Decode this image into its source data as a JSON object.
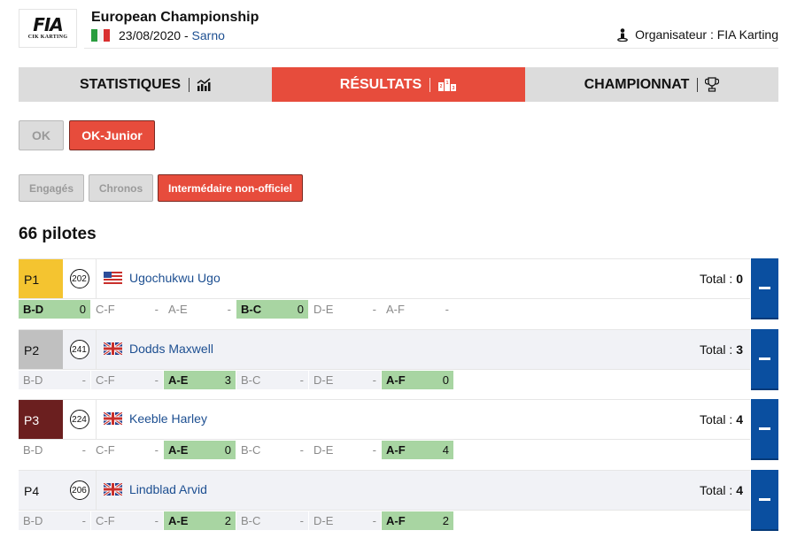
{
  "header": {
    "logo_text": "FIA",
    "logo_subtext": "CIK KARTING",
    "event_title": "European Championship",
    "event_flag": "italy-flag",
    "event_date": "23/08/2020",
    "date_separator": " - ",
    "event_place": "Sarno",
    "organiser_icon": "person-icon",
    "organiser": "Organisateur : FIA Karting"
  },
  "tabs": [
    {
      "label": "STATISTIQUES",
      "icon": "chart-icon",
      "active": false
    },
    {
      "label": "RÉSULTATS",
      "icon": "podium-icon",
      "active": true
    },
    {
      "label": "CHAMPIONNAT",
      "icon": "trophy-icon",
      "active": false
    }
  ],
  "categories": [
    {
      "label": "OK",
      "active": false
    },
    {
      "label": "OK-Junior",
      "active": true
    }
  ],
  "sessions": [
    {
      "label": "Engagés",
      "active": false
    },
    {
      "label": "Chronos",
      "active": false
    },
    {
      "label": "Intermédaire non-officiel",
      "active": true
    }
  ],
  "pilot_count": "66 pilotes",
  "colors": {
    "accent_red": "#e74c3c",
    "link_blue": "#1d4f91",
    "toggle_blue": "#0a4fa0",
    "p1": "#f4c430",
    "p2": "#c0c0c0",
    "p3": "#6b1f1f",
    "scored_green": "#a8d5a2"
  },
  "pilots": [
    {
      "position": "P1",
      "number": "202",
      "flag": "usa-flag",
      "name": "Ugochukwu Ugo",
      "total_label": "Total : ",
      "total": "0",
      "heats": [
        {
          "label": "B-D",
          "value": "0",
          "scored": true
        },
        {
          "label": "C-F",
          "value": "-",
          "scored": false
        },
        {
          "label": "A-E",
          "value": "-",
          "scored": false
        },
        {
          "label": "B-C",
          "value": "0",
          "scored": true
        },
        {
          "label": "D-E",
          "value": "-",
          "scored": false
        },
        {
          "label": "A-F",
          "value": "-",
          "scored": false
        }
      ]
    },
    {
      "position": "P2",
      "number": "241",
      "flag": "uk-flag",
      "name": "Dodds Maxwell",
      "total_label": "Total : ",
      "total": "3",
      "heats": [
        {
          "label": "B-D",
          "value": "-",
          "scored": false
        },
        {
          "label": "C-F",
          "value": "-",
          "scored": false
        },
        {
          "label": "A-E",
          "value": "3",
          "scored": true
        },
        {
          "label": "B-C",
          "value": "-",
          "scored": false
        },
        {
          "label": "D-E",
          "value": "-",
          "scored": false
        },
        {
          "label": "A-F",
          "value": "0",
          "scored": true
        }
      ]
    },
    {
      "position": "P3",
      "number": "224",
      "flag": "uk-flag",
      "name": "Keeble Harley",
      "total_label": "Total : ",
      "total": "4",
      "heats": [
        {
          "label": "B-D",
          "value": "-",
          "scored": false
        },
        {
          "label": "C-F",
          "value": "-",
          "scored": false
        },
        {
          "label": "A-E",
          "value": "0",
          "scored": true
        },
        {
          "label": "B-C",
          "value": "-",
          "scored": false
        },
        {
          "label": "D-E",
          "value": "-",
          "scored": false
        },
        {
          "label": "A-F",
          "value": "4",
          "scored": true
        }
      ]
    },
    {
      "position": "P4",
      "number": "206",
      "flag": "uk-flag",
      "name": "Lindblad Arvid",
      "total_label": "Total : ",
      "total": "4",
      "heats": [
        {
          "label": "B-D",
          "value": "-",
          "scored": false
        },
        {
          "label": "C-F",
          "value": "-",
          "scored": false
        },
        {
          "label": "A-E",
          "value": "2",
          "scored": true
        },
        {
          "label": "B-C",
          "value": "-",
          "scored": false
        },
        {
          "label": "D-E",
          "value": "-",
          "scored": false
        },
        {
          "label": "A-F",
          "value": "2",
          "scored": true
        }
      ]
    }
  ]
}
